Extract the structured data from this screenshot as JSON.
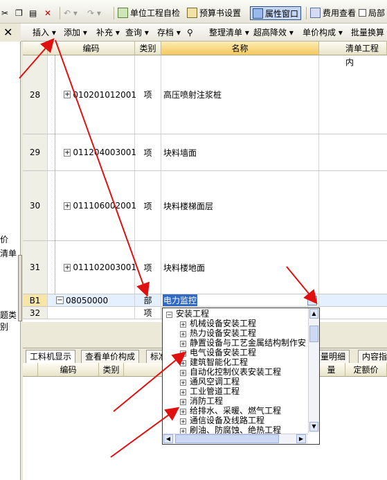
{
  "toolbar": {
    "items": [
      "单位工程自检",
      "预算书设置",
      "属性窗口",
      "费用查看",
      "局部"
    ],
    "checkbox_label": ""
  },
  "menu": {
    "items": [
      "插入",
      "添加",
      "补充",
      "查询",
      "存档",
      "整理清单",
      "超高降效",
      "单价构成",
      "批量换算"
    ]
  },
  "grid": {
    "columns": [
      "编码",
      "类别",
      "名称",
      "清单工程内"
    ],
    "rows": [
      {
        "no": "28",
        "code": "010201012001",
        "type": "项",
        "name": "高压喷射注浆桩"
      },
      {
        "no": "29",
        "code": "011204003001",
        "type": "项",
        "name": "块料墙面"
      },
      {
        "no": "30",
        "code": "011106002001",
        "type": "项",
        "name": "块料楼梯面层"
      },
      {
        "no": "31",
        "code": "011102003001",
        "type": "项",
        "name": "块料楼地面"
      },
      {
        "no": "B1",
        "code": "08050000",
        "type": "部",
        "name": "电力监控"
      },
      {
        "no": "32",
        "code": "",
        "type": "项",
        "name": ""
      }
    ]
  },
  "left_panel": {
    "labels": [
      "价",
      "清单",
      "题类别"
    ]
  },
  "bottom": {
    "tabs": [
      "工料机显示",
      "查看单价构成",
      "标准",
      "量明细",
      "内容指"
    ],
    "columns": [
      "编码",
      "类别",
      "量",
      "定额价"
    ]
  },
  "dropdown": {
    "root": "安装工程",
    "items": [
      "机械设备安装工程",
      "热力设备安装工程",
      "静置设备与工艺金属结构制作安",
      "电气设备安装工程",
      "建筑智能化工程",
      "自动化控制仪表安装工程",
      "通风空调工程",
      "工业管道工程",
      "消防工程",
      "给排水、采暖、燃气工程",
      "通信设备及线路工程",
      "刷油、防腐蚀、绝热工程"
    ]
  },
  "colors": {
    "arrow": "#e01010",
    "selection": "#316ac5",
    "header_selected": "#f4c85e"
  }
}
